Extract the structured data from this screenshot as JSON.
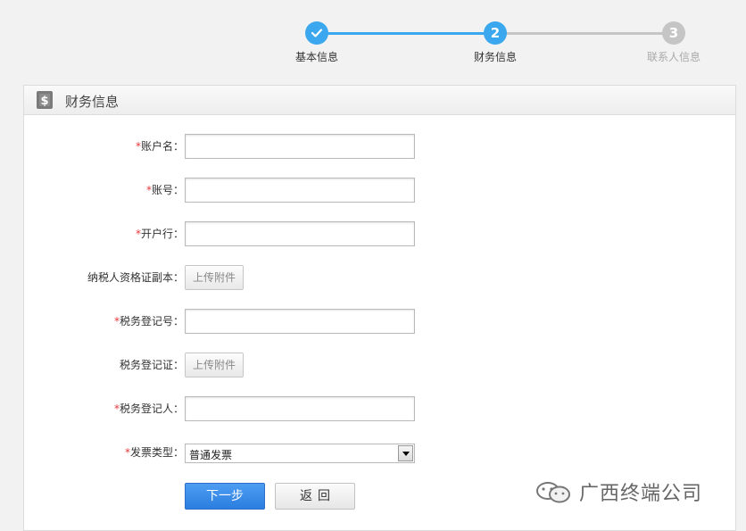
{
  "steps": [
    {
      "label": "基本信息",
      "state": "done",
      "icon": "check-icon"
    },
    {
      "label": "财务信息",
      "number": "2",
      "state": "active"
    },
    {
      "label": "联系人信息",
      "number": "3",
      "state": "pending"
    }
  ],
  "colors": {
    "active": "#3aa7ee",
    "pending": "#c5c5c5",
    "required": "#e4393c",
    "primary": "#2b7ee0"
  },
  "panel": {
    "title": "财务信息",
    "icon": "dollar-document-icon"
  },
  "form": {
    "account_name": {
      "required_mark": "*",
      "label": "账户名：",
      "value": ""
    },
    "account_no": {
      "required_mark": "*",
      "label": "账号：",
      "value": ""
    },
    "bank": {
      "required_mark": "*",
      "label": "开户行：",
      "value": ""
    },
    "taxpayer_cert": {
      "label": "纳税人资格证副本：",
      "button": "上传附件"
    },
    "tax_reg_no": {
      "required_mark": "*",
      "label": "税务登记号：",
      "value": ""
    },
    "tax_reg_cert": {
      "label": "税务登记证：",
      "button": "上传附件"
    },
    "tax_reg_person": {
      "required_mark": "*",
      "label": "税务登记人：",
      "value": ""
    },
    "invoice_type": {
      "required_mark": "*",
      "label": "发票类型：",
      "value": "普通发票"
    }
  },
  "actions": {
    "next": "下一步",
    "back": "返回"
  },
  "watermark": {
    "text": "广西终端公司",
    "icon": "wechat-icon"
  }
}
